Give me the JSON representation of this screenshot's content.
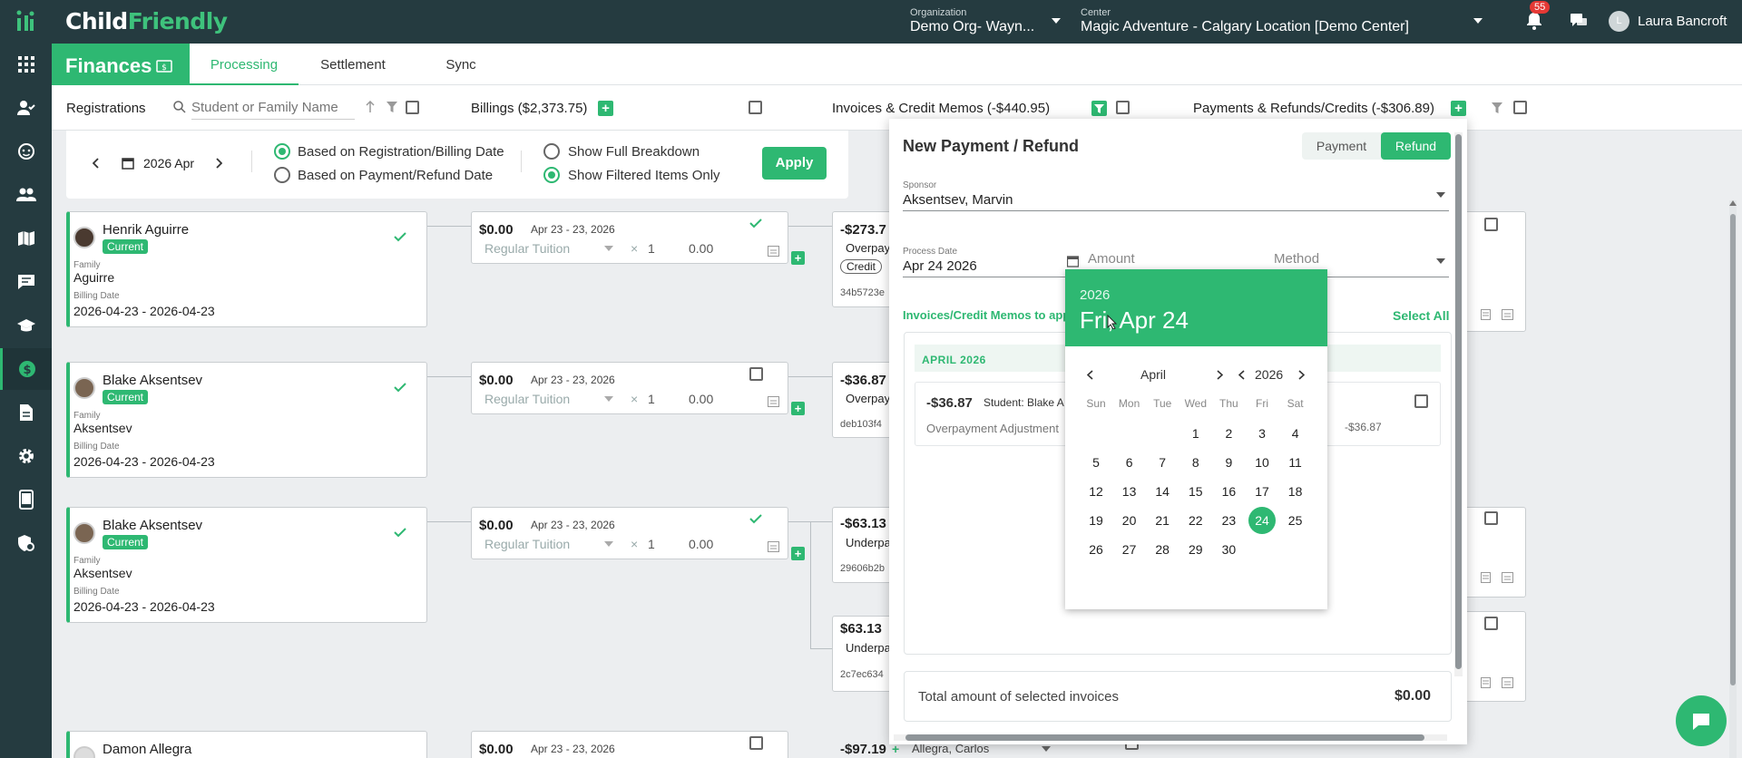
{
  "app": {
    "logo_left": "Child",
    "logo_right": "Friendly"
  },
  "topbar": {
    "org_label": "Organization",
    "org_value": "Demo Org- Wayn...",
    "center_label": "Center",
    "center_value": "Magic Adventure - Calgary Location [Demo Center]",
    "notifications_count": "55",
    "user_initial": "L",
    "user_name": "Laura Bancroft"
  },
  "sidebar": {
    "icons": [
      "apps-grid-icon",
      "person-check-icon",
      "face-icon",
      "people-icon",
      "map-icon",
      "chat-icon",
      "school-icon",
      "dollar-icon",
      "document-icon",
      "gear-icon",
      "tablet-icon",
      "shield-settings-icon"
    ],
    "active": "dollar-icon"
  },
  "tabs": {
    "section": "Finances",
    "items": [
      "Processing",
      "Settlement",
      "Sync"
    ],
    "active": "Processing"
  },
  "filter": {
    "registrations": "Registrations",
    "search_placeholder": "Student or Family Name",
    "billings": "Billings ($2,373.75)",
    "invoices": "Invoices & Credit Memos (-$440.95)",
    "payments": "Payments & Refunds/Credits (-$306.89)"
  },
  "dates": {
    "period": "2026 Apr",
    "opt_registration": "Based on Registration/Billing Date",
    "opt_payment": "Based on Payment/Refund Date",
    "opt_full": "Show Full Breakdown",
    "opt_filtered": "Show Filtered Items Only",
    "apply": "Apply"
  },
  "registrations": [
    {
      "name": "Henrik Aguirre",
      "status": "Current",
      "family_label": "Family",
      "family": "Aguirre",
      "billing_label": "Billing Date",
      "billing": "2026-04-23 - 2026-04-23"
    },
    {
      "name": "Blake Aksentsev",
      "status": "Current",
      "family_label": "Family",
      "family": "Aksentsev",
      "billing_label": "Billing Date",
      "billing": "2026-04-23 - 2026-04-23"
    },
    {
      "name": "Blake Aksentsev",
      "status": "Current",
      "family_label": "Family",
      "family": "Aksentsev",
      "billing_label": "Billing Date",
      "billing": "2026-04-23 - 2026-04-23"
    },
    {
      "name": "Damon Allegra"
    }
  ],
  "billings": [
    {
      "amount": "$0.00",
      "dates": "Apr 23 - 23, 2026",
      "item": "Regular Tuition",
      "times": "×",
      "qty": "1",
      "total": "0.00"
    },
    {
      "amount": "$0.00",
      "dates": "Apr 23 - 23, 2026",
      "item": "Regular Tuition",
      "times": "×",
      "qty": "1",
      "total": "0.00"
    },
    {
      "amount": "$0.00",
      "dates": "Apr 23 - 23, 2026",
      "item": "Regular Tuition",
      "times": "×",
      "qty": "1",
      "total": "0.00"
    },
    {
      "amount": "$0.00",
      "dates": "Apr 23 - 23, 2026"
    }
  ],
  "invoices": [
    {
      "amount": "-$273.7",
      "type": "Overpay",
      "tag": "Credit",
      "id": "34b5723e"
    },
    {
      "amount": "-$36.87",
      "type": "Overpay",
      "id": "deb103f4"
    },
    {
      "amount": "-$63.13",
      "type": "Underpa",
      "id": "29606b2b"
    },
    {
      "amount": "$63.13",
      "type": "Underpa",
      "id": "2c7ec634"
    },
    {
      "amount": "-$97.19",
      "sponsor": "Allegra, Carlos"
    }
  ],
  "modal": {
    "title": "New Payment / Refund",
    "seg_payment": "Payment",
    "seg_refund": "Refund",
    "sponsor_label": "Sponsor",
    "sponsor": "Aksentsev, Marvin",
    "process_label": "Process Date",
    "process_date": "Apr 24 2026",
    "amount_label": "Amount",
    "method_label": "Method",
    "invoices_label": "Invoices/Credit Memos to app",
    "select_all": "Select All",
    "month_header": "APRIL 2026",
    "item_amount": "-$36.87",
    "item_student": "Student: Blake A",
    "item_desc": "Overpayment Adjustment",
    "item_right": "-$36.87",
    "total_label": "Total amount of selected invoices",
    "total": "$0.00"
  },
  "calendar": {
    "year_small": "2026",
    "selected_label": "Fri, Apr 24",
    "month": "April",
    "year": "2026",
    "weekdays": [
      "Sun",
      "Mon",
      "Tue",
      "Wed",
      "Thu",
      "Fri",
      "Sat"
    ],
    "first_weekday": 3,
    "days_in_month": 30,
    "selected_day": 24
  },
  "colors": {
    "accent": "#2eb872",
    "dark": "#253b40"
  }
}
